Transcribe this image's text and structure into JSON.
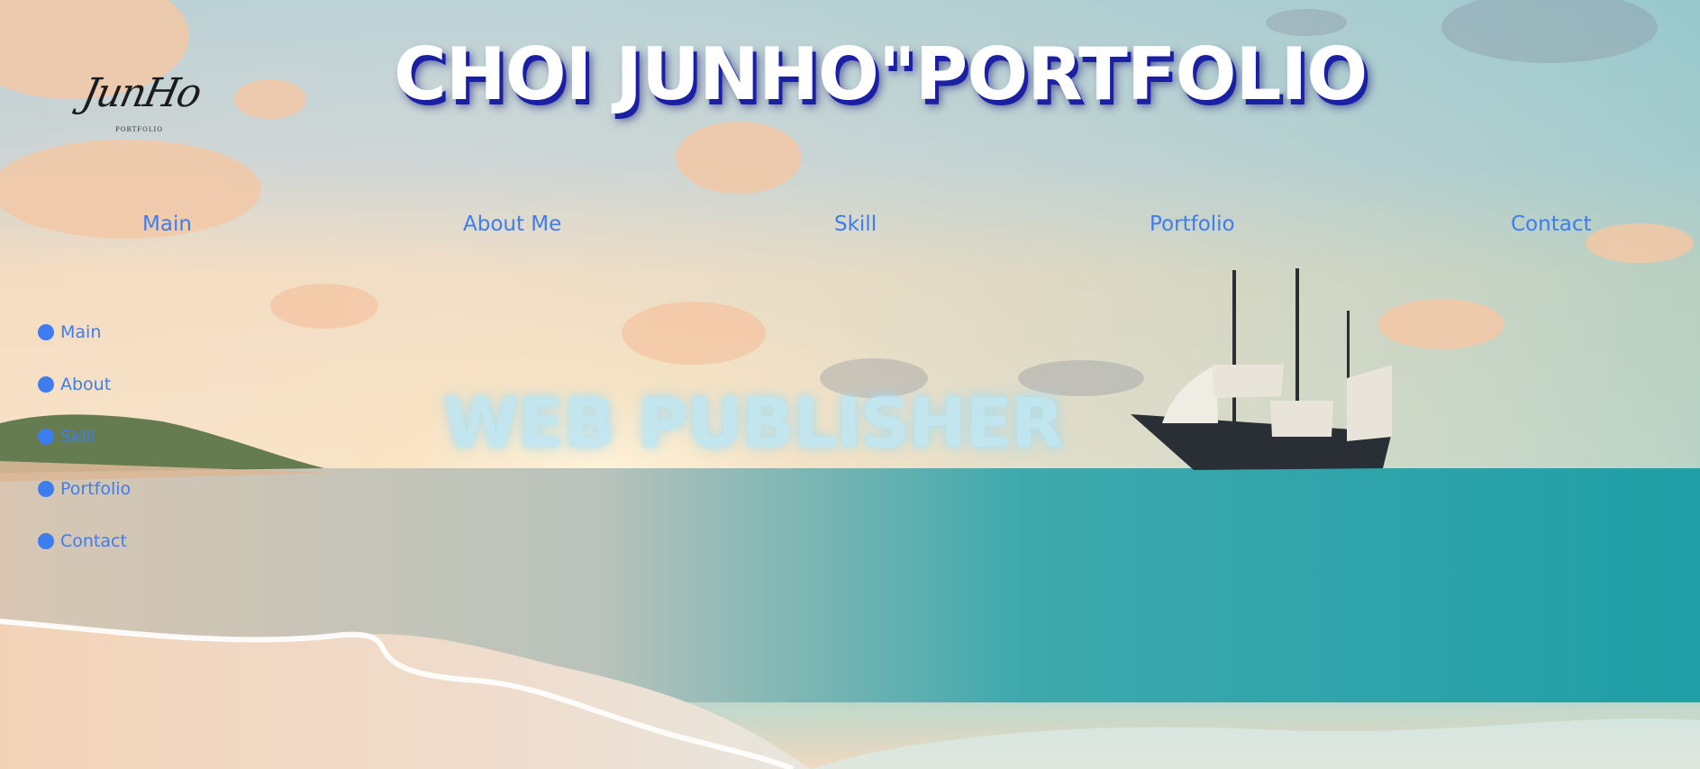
{
  "brand": {
    "logo_text": "JunHo",
    "logo_subtext": "PORTFOLIO"
  },
  "header": {
    "title": "CHOI JUNHO\"PORTFOLIO"
  },
  "top_nav": {
    "items": [
      {
        "label": "Main"
      },
      {
        "label": "About Me"
      },
      {
        "label": "Skill"
      },
      {
        "label": "Portfolio"
      },
      {
        "label": "Contact"
      }
    ]
  },
  "side_nav": {
    "items": [
      {
        "label": "Main"
      },
      {
        "label": "About"
      },
      {
        "label": "Skill"
      },
      {
        "label": "Portfolio"
      },
      {
        "label": "Contact"
      }
    ]
  },
  "hero": {
    "subtitle": "WEB PUBLISHER"
  },
  "colors": {
    "nav_link": "#3d7df0",
    "title_text": "#ffffff",
    "title_shadow": "#1a1fa3",
    "hero_subtitle": "#bfe6f2"
  },
  "icons": {
    "side_bullet": "dot-icon"
  }
}
